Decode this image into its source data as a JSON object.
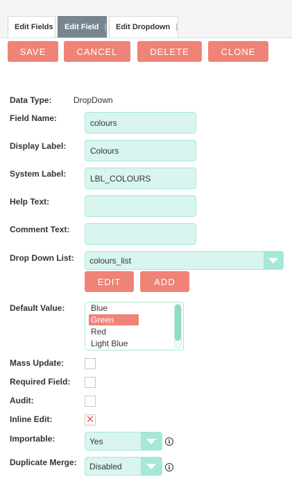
{
  "tabs": [
    {
      "label": "Edit Fields",
      "active": false
    },
    {
      "label": "Edit Field",
      "active": true
    },
    {
      "label": "Edit Dropdown",
      "active": false
    }
  ],
  "actions": {
    "save": "SAVE",
    "cancel": "CANCEL",
    "delete": "DELETE",
    "clone": "CLONE"
  },
  "form": {
    "data_type": {
      "label": "Data Type:",
      "value": "DropDown"
    },
    "field_name": {
      "label": "Field Name:",
      "value": "colours"
    },
    "display_label": {
      "label": "Display Label:",
      "value": "Colours"
    },
    "system_label": {
      "label": "System Label:",
      "value": "LBL_COLOURS"
    },
    "help_text": {
      "label": "Help Text:",
      "value": ""
    },
    "comment_text": {
      "label": "Comment Text:",
      "value": ""
    },
    "drop_down_list": {
      "label": "Drop Down List:",
      "value": "colours_list",
      "edit": "EDIT",
      "add": "ADD"
    },
    "default_value": {
      "label": "Default Value:",
      "options": [
        "Blue",
        "Green",
        "Red",
        "Light Blue"
      ],
      "selected": "Green"
    },
    "mass_update": {
      "label": "Mass Update:",
      "checked": false
    },
    "required_field": {
      "label": "Required Field:",
      "checked": false
    },
    "audit": {
      "label": "Audit:",
      "checked": false
    },
    "inline_edit": {
      "label": "Inline Edit:",
      "checked": true
    },
    "importable": {
      "label": "Importable:",
      "value": "Yes"
    },
    "duplicate_merge": {
      "label": "Duplicate Merge:",
      "value": "Disabled"
    }
  },
  "colors": {
    "accent": "#f08377",
    "input_bg": "#d8f5ef",
    "input_border": "#a5e8d6",
    "active_tab": "#778591"
  },
  "icons": {
    "dropdown": "chevron-down-icon",
    "info": "info-icon",
    "checked": "x-mark-icon"
  }
}
